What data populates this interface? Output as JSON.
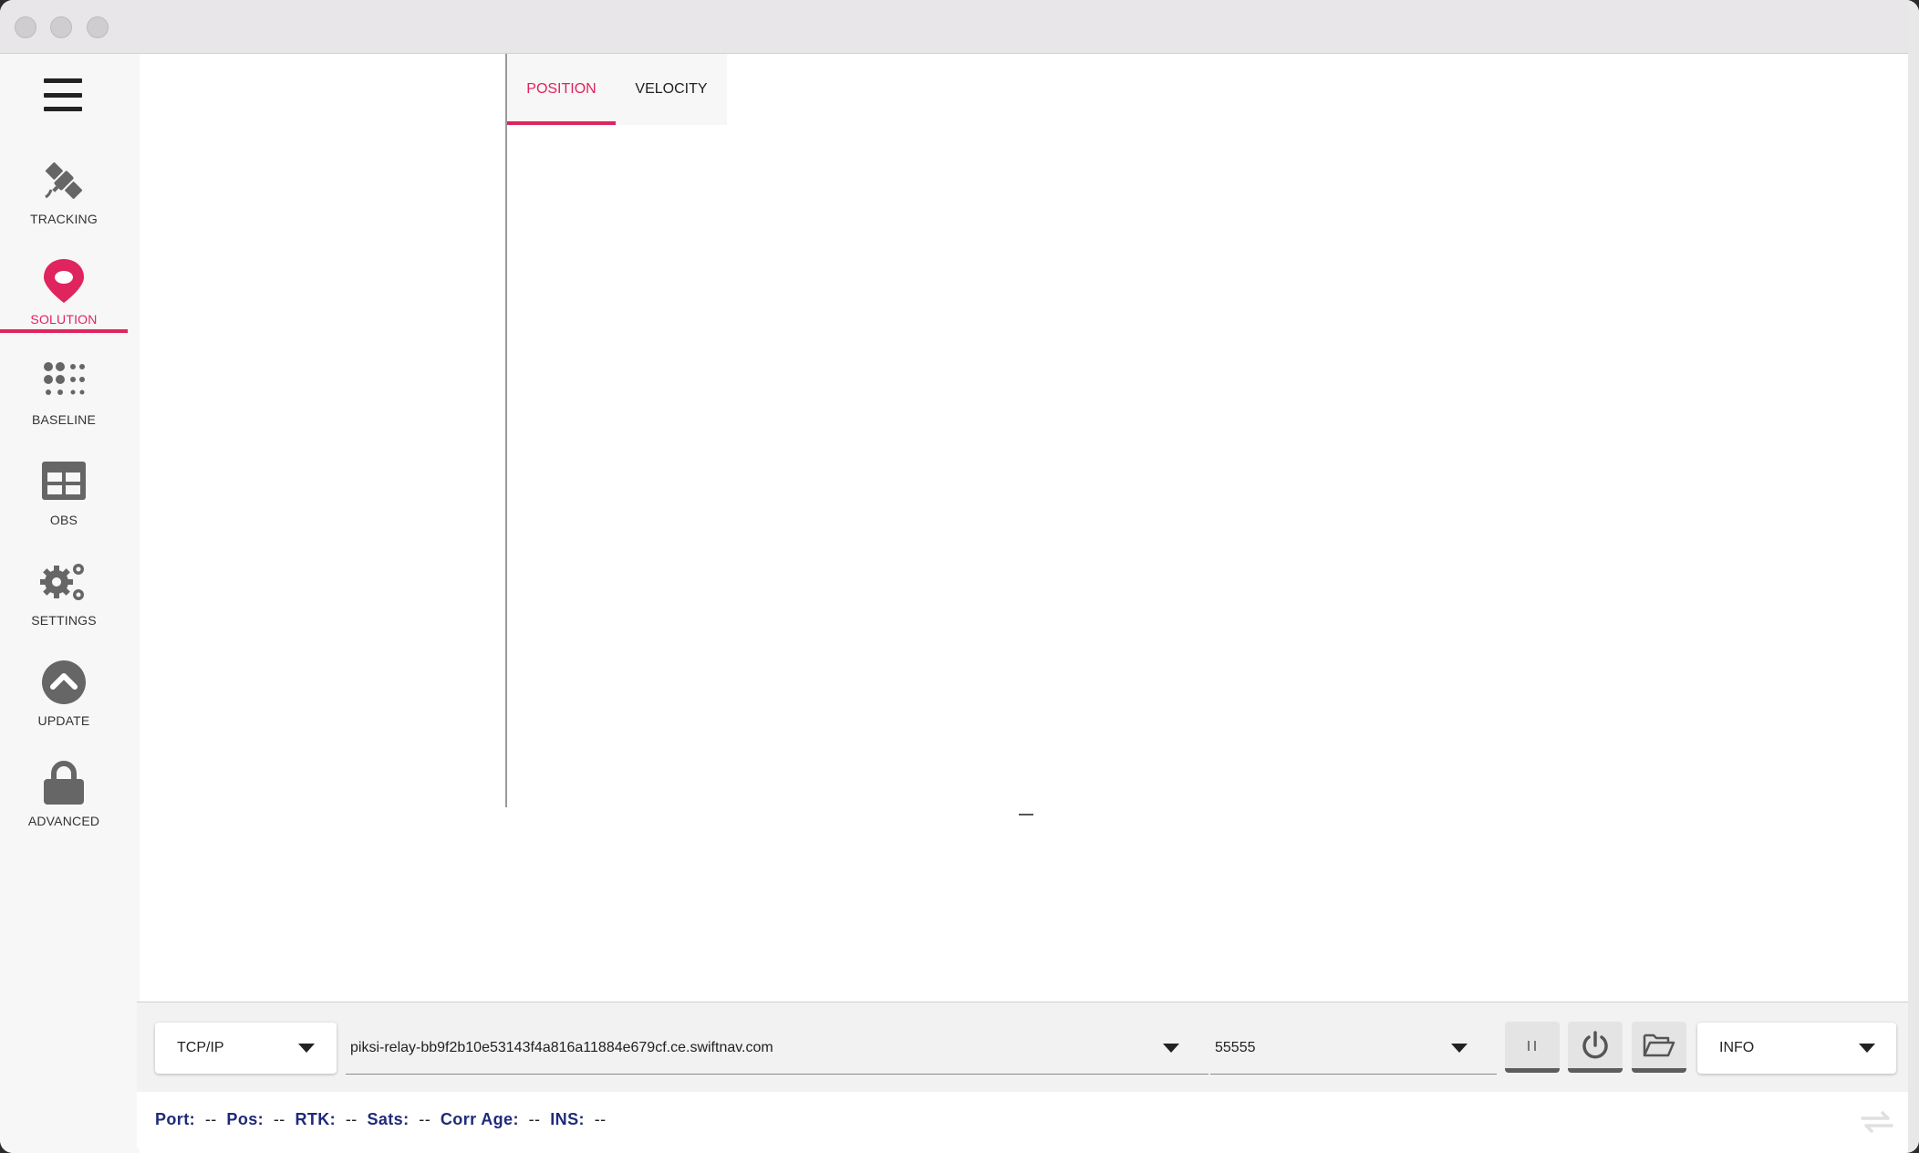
{
  "window": {
    "controls": [
      "close",
      "minimize",
      "maximize"
    ]
  },
  "sidebar": {
    "menu_icon": "hamburger-menu-icon",
    "items": [
      {
        "label": "TRACKING",
        "icon": "satellite-icon",
        "active": false
      },
      {
        "label": "SOLUTION",
        "icon": "map-pin-icon",
        "active": true
      },
      {
        "label": "BASELINE",
        "icon": "dots-grid-icon",
        "active": false
      },
      {
        "label": "OBS",
        "icon": "table-grid-icon",
        "active": false
      },
      {
        "label": "SETTINGS",
        "icon": "gears-icon",
        "active": false
      },
      {
        "label": "UPDATE",
        "icon": "chevron-up-circle-icon",
        "active": false
      },
      {
        "label": "ADVANCED",
        "icon": "lock-icon",
        "active": false
      }
    ]
  },
  "tabs": [
    {
      "label": "POSITION",
      "active": true
    },
    {
      "label": "VELOCITY",
      "active": false
    }
  ],
  "connection": {
    "type": "TCP/IP",
    "host": "piksi-relay-bb9f2b10e53143f4a816a11884e679cf.ce.swiftnav.com",
    "port": "55555",
    "buttons": [
      "pause-icon",
      "power-icon",
      "folder-open-icon"
    ],
    "log_level": "INFO"
  },
  "status": {
    "port_label": "Port:",
    "port_value": "--",
    "pos_label": "Pos:",
    "pos_value": "--",
    "rtk_label": "RTK:",
    "rtk_value": "--",
    "sats_label": "Sats:",
    "sats_value": "--",
    "corr_age_label": "Corr Age:",
    "corr_age_value": "--",
    "ins_label": "INS:",
    "ins_value": "--",
    "refresh_icon": "swap-arrows-icon"
  },
  "colors": {
    "accent": "#e0245e",
    "status_label": "#1f2a7a",
    "icon_gray": "#666666"
  }
}
